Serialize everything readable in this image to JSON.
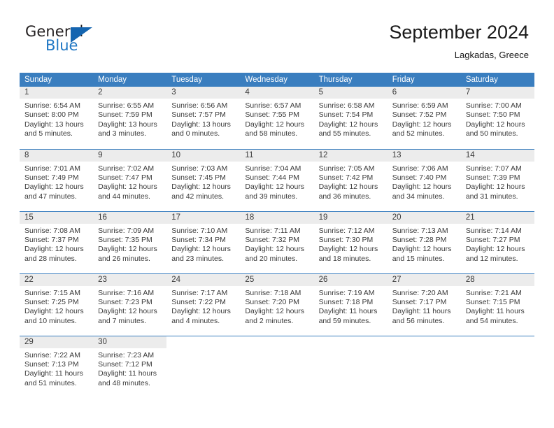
{
  "logo": {
    "word1": "General",
    "word2": "Blue",
    "triangle_color": "#1565b0",
    "blue_color": "#1f77c4"
  },
  "header": {
    "title": "September 2024",
    "subtitle": "Lagkadas, Greece"
  },
  "theme": {
    "header_blue": "#3a7ebf",
    "daynum_gray": "#ececec",
    "text": "#3a3a3a"
  },
  "calendar": {
    "weekday_headers": [
      "Sunday",
      "Monday",
      "Tuesday",
      "Wednesday",
      "Thursday",
      "Friday",
      "Saturday"
    ],
    "labels": {
      "sunrise": "Sunrise:",
      "sunset": "Sunset:",
      "daylight": "Daylight:"
    },
    "weeks": [
      [
        {
          "day": "1",
          "sunrise": "Sunrise: 6:54 AM",
          "sunset": "Sunset: 8:00 PM",
          "daylight1": "Daylight: 13 hours",
          "daylight2": "and 5 minutes."
        },
        {
          "day": "2",
          "sunrise": "Sunrise: 6:55 AM",
          "sunset": "Sunset: 7:59 PM",
          "daylight1": "Daylight: 13 hours",
          "daylight2": "and 3 minutes."
        },
        {
          "day": "3",
          "sunrise": "Sunrise: 6:56 AM",
          "sunset": "Sunset: 7:57 PM",
          "daylight1": "Daylight: 13 hours",
          "daylight2": "and 0 minutes."
        },
        {
          "day": "4",
          "sunrise": "Sunrise: 6:57 AM",
          "sunset": "Sunset: 7:55 PM",
          "daylight1": "Daylight: 12 hours",
          "daylight2": "and 58 minutes."
        },
        {
          "day": "5",
          "sunrise": "Sunrise: 6:58 AM",
          "sunset": "Sunset: 7:54 PM",
          "daylight1": "Daylight: 12 hours",
          "daylight2": "and 55 minutes."
        },
        {
          "day": "6",
          "sunrise": "Sunrise: 6:59 AM",
          "sunset": "Sunset: 7:52 PM",
          "daylight1": "Daylight: 12 hours",
          "daylight2": "and 52 minutes."
        },
        {
          "day": "7",
          "sunrise": "Sunrise: 7:00 AM",
          "sunset": "Sunset: 7:50 PM",
          "daylight1": "Daylight: 12 hours",
          "daylight2": "and 50 minutes."
        }
      ],
      [
        {
          "day": "8",
          "sunrise": "Sunrise: 7:01 AM",
          "sunset": "Sunset: 7:49 PM",
          "daylight1": "Daylight: 12 hours",
          "daylight2": "and 47 minutes."
        },
        {
          "day": "9",
          "sunrise": "Sunrise: 7:02 AM",
          "sunset": "Sunset: 7:47 PM",
          "daylight1": "Daylight: 12 hours",
          "daylight2": "and 44 minutes."
        },
        {
          "day": "10",
          "sunrise": "Sunrise: 7:03 AM",
          "sunset": "Sunset: 7:45 PM",
          "daylight1": "Daylight: 12 hours",
          "daylight2": "and 42 minutes."
        },
        {
          "day": "11",
          "sunrise": "Sunrise: 7:04 AM",
          "sunset": "Sunset: 7:44 PM",
          "daylight1": "Daylight: 12 hours",
          "daylight2": "and 39 minutes."
        },
        {
          "day": "12",
          "sunrise": "Sunrise: 7:05 AM",
          "sunset": "Sunset: 7:42 PM",
          "daylight1": "Daylight: 12 hours",
          "daylight2": "and 36 minutes."
        },
        {
          "day": "13",
          "sunrise": "Sunrise: 7:06 AM",
          "sunset": "Sunset: 7:40 PM",
          "daylight1": "Daylight: 12 hours",
          "daylight2": "and 34 minutes."
        },
        {
          "day": "14",
          "sunrise": "Sunrise: 7:07 AM",
          "sunset": "Sunset: 7:39 PM",
          "daylight1": "Daylight: 12 hours",
          "daylight2": "and 31 minutes."
        }
      ],
      [
        {
          "day": "15",
          "sunrise": "Sunrise: 7:08 AM",
          "sunset": "Sunset: 7:37 PM",
          "daylight1": "Daylight: 12 hours",
          "daylight2": "and 28 minutes."
        },
        {
          "day": "16",
          "sunrise": "Sunrise: 7:09 AM",
          "sunset": "Sunset: 7:35 PM",
          "daylight1": "Daylight: 12 hours",
          "daylight2": "and 26 minutes."
        },
        {
          "day": "17",
          "sunrise": "Sunrise: 7:10 AM",
          "sunset": "Sunset: 7:34 PM",
          "daylight1": "Daylight: 12 hours",
          "daylight2": "and 23 minutes."
        },
        {
          "day": "18",
          "sunrise": "Sunrise: 7:11 AM",
          "sunset": "Sunset: 7:32 PM",
          "daylight1": "Daylight: 12 hours",
          "daylight2": "and 20 minutes."
        },
        {
          "day": "19",
          "sunrise": "Sunrise: 7:12 AM",
          "sunset": "Sunset: 7:30 PM",
          "daylight1": "Daylight: 12 hours",
          "daylight2": "and 18 minutes."
        },
        {
          "day": "20",
          "sunrise": "Sunrise: 7:13 AM",
          "sunset": "Sunset: 7:28 PM",
          "daylight1": "Daylight: 12 hours",
          "daylight2": "and 15 minutes."
        },
        {
          "day": "21",
          "sunrise": "Sunrise: 7:14 AM",
          "sunset": "Sunset: 7:27 PM",
          "daylight1": "Daylight: 12 hours",
          "daylight2": "and 12 minutes."
        }
      ],
      [
        {
          "day": "22",
          "sunrise": "Sunrise: 7:15 AM",
          "sunset": "Sunset: 7:25 PM",
          "daylight1": "Daylight: 12 hours",
          "daylight2": "and 10 minutes."
        },
        {
          "day": "23",
          "sunrise": "Sunrise: 7:16 AM",
          "sunset": "Sunset: 7:23 PM",
          "daylight1": "Daylight: 12 hours",
          "daylight2": "and 7 minutes."
        },
        {
          "day": "24",
          "sunrise": "Sunrise: 7:17 AM",
          "sunset": "Sunset: 7:22 PM",
          "daylight1": "Daylight: 12 hours",
          "daylight2": "and 4 minutes."
        },
        {
          "day": "25",
          "sunrise": "Sunrise: 7:18 AM",
          "sunset": "Sunset: 7:20 PM",
          "daylight1": "Daylight: 12 hours",
          "daylight2": "and 2 minutes."
        },
        {
          "day": "26",
          "sunrise": "Sunrise: 7:19 AM",
          "sunset": "Sunset: 7:18 PM",
          "daylight1": "Daylight: 11 hours",
          "daylight2": "and 59 minutes."
        },
        {
          "day": "27",
          "sunrise": "Sunrise: 7:20 AM",
          "sunset": "Sunset: 7:17 PM",
          "daylight1": "Daylight: 11 hours",
          "daylight2": "and 56 minutes."
        },
        {
          "day": "28",
          "sunrise": "Sunrise: 7:21 AM",
          "sunset": "Sunset: 7:15 PM",
          "daylight1": "Daylight: 11 hours",
          "daylight2": "and 54 minutes."
        }
      ],
      [
        {
          "day": "29",
          "sunrise": "Sunrise: 7:22 AM",
          "sunset": "Sunset: 7:13 PM",
          "daylight1": "Daylight: 11 hours",
          "daylight2": "and 51 minutes."
        },
        {
          "day": "30",
          "sunrise": "Sunrise: 7:23 AM",
          "sunset": "Sunset: 7:12 PM",
          "daylight1": "Daylight: 11 hours",
          "daylight2": "and 48 minutes."
        },
        {
          "day": "",
          "sunrise": "",
          "sunset": "",
          "daylight1": "",
          "daylight2": ""
        },
        {
          "day": "",
          "sunrise": "",
          "sunset": "",
          "daylight1": "",
          "daylight2": ""
        },
        {
          "day": "",
          "sunrise": "",
          "sunset": "",
          "daylight1": "",
          "daylight2": ""
        },
        {
          "day": "",
          "sunrise": "",
          "sunset": "",
          "daylight1": "",
          "daylight2": ""
        },
        {
          "day": "",
          "sunrise": "",
          "sunset": "",
          "daylight1": "",
          "daylight2": ""
        }
      ]
    ]
  }
}
